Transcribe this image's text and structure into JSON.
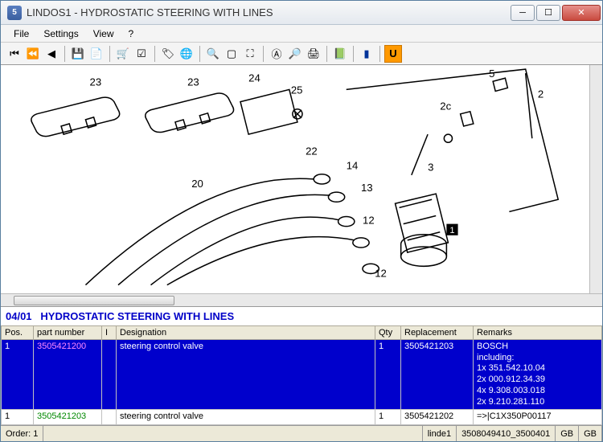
{
  "window": {
    "title": "LINDOS1 - HYDROSTATIC STEERING WITH LINES"
  },
  "menu": {
    "file": "File",
    "settings": "Settings",
    "view": "View",
    "help": "?"
  },
  "diagram": {
    "callouts": [
      "23",
      "23",
      "24",
      "25",
      "22",
      "20",
      "14",
      "13",
      "12",
      "12",
      "2c",
      "3",
      "5",
      "2",
      "1"
    ]
  },
  "section": {
    "code": "04/01",
    "title": "HYDROSTATIC STEERING WITH LINES"
  },
  "columns": {
    "pos": "Pos.",
    "partnum": "part number",
    "i": "I",
    "designation": "Designation",
    "qty": "Qty",
    "replacement": "Replacement",
    "remarks": "Remarks"
  },
  "rows": [
    {
      "pos": "1",
      "partnum": "3505421200",
      "i": "",
      "designation": "steering control valve",
      "qty": "1",
      "replacement": "3505421203",
      "remarks": "BOSCH\nincluding:\n1x 351.542.10.04\n2x 000.912.34.39\n4x 9.308.003.018\n2x 9.210.281.110",
      "selected": true
    },
    {
      "pos": "1",
      "partnum": "3505421203",
      "i": "",
      "designation": "steering control valve",
      "qty": "1",
      "replacement": "3505421202",
      "remarks": "=>|C1X350P00117",
      "selected": false
    }
  ],
  "status": {
    "order_label": "Order:",
    "order_value": "1",
    "user": "linde1",
    "code": "3508049410_3500401",
    "lang1": "GB",
    "lang2": "GB"
  }
}
